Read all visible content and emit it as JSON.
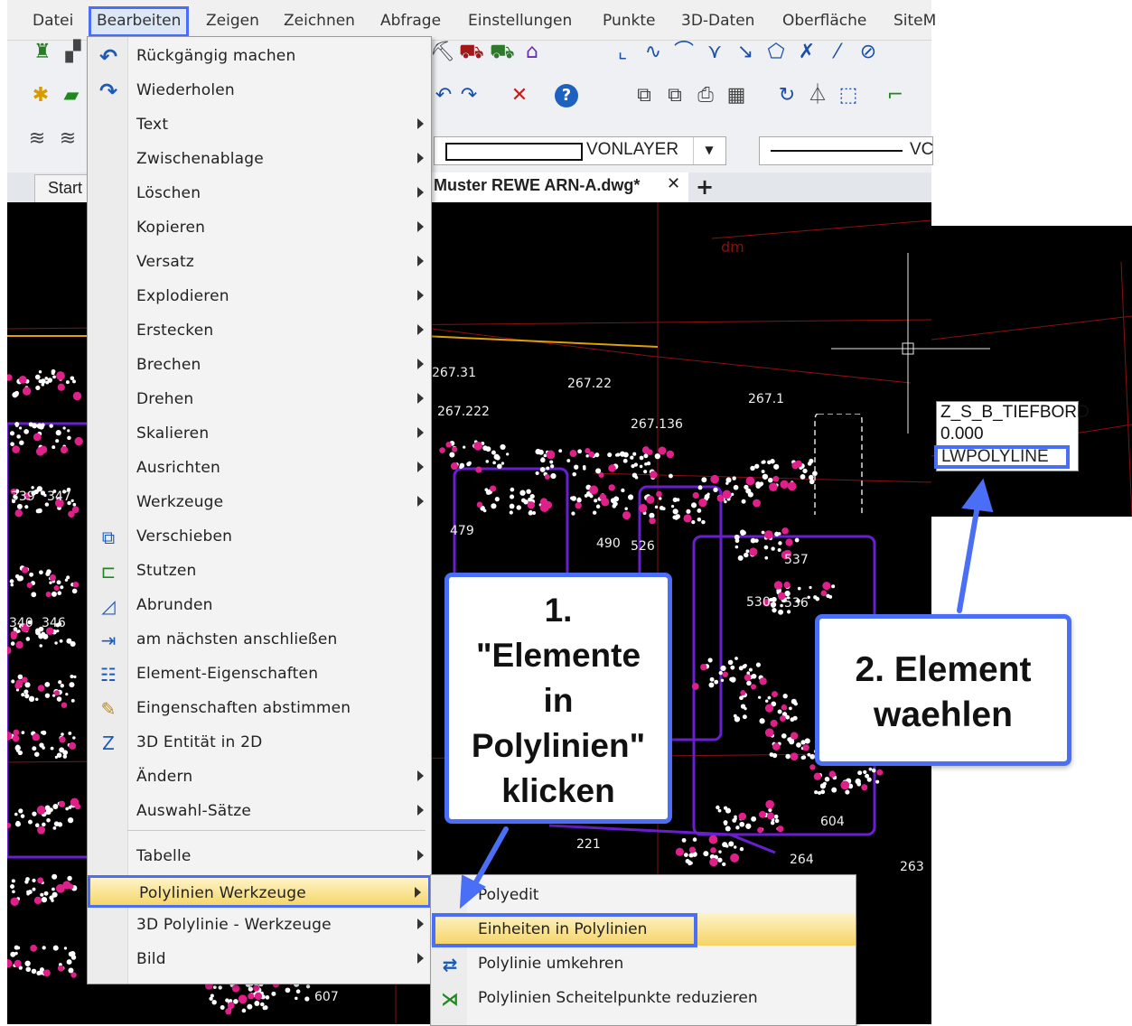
{
  "menubar": {
    "items": [
      "Datei",
      "Bearbeiten",
      "Zeigen",
      "Zeichnen",
      "Abfrage",
      "Einstellungen",
      "Punkte",
      "3D-Daten",
      "Oberfläche",
      "SiteM"
    ]
  },
  "toolbar": {
    "linetype_value": "VONLAYER",
    "linetype2_value": "VC"
  },
  "tabs": {
    "start": "Start",
    "document": "Muster REWE ARN-A.dwg*",
    "close": "✕",
    "add": "+"
  },
  "menu": {
    "items": [
      {
        "label": "Rückgängig machen",
        "icon": "undo-icon"
      },
      {
        "label": "Wiederholen",
        "icon": "redo-icon"
      },
      {
        "label": "Text",
        "submenu": true
      },
      {
        "label": "Zwischenablage",
        "submenu": true
      },
      {
        "label": "Löschen",
        "submenu": true
      },
      {
        "label": "Kopieren",
        "submenu": true
      },
      {
        "label": "Versatz",
        "submenu": true
      },
      {
        "label": "Explodieren",
        "submenu": true
      },
      {
        "label": "Erstecken",
        "submenu": true
      },
      {
        "label": "Brechen",
        "submenu": true
      },
      {
        "label": "Drehen",
        "submenu": true
      },
      {
        "label": "Skalieren",
        "submenu": true
      },
      {
        "label": "Ausrichten",
        "submenu": true
      },
      {
        "label": "Werkzeuge",
        "submenu": true
      },
      {
        "label": "Verschieben",
        "icon": "move-icon"
      },
      {
        "label": "Stutzen",
        "icon": "trim-icon"
      },
      {
        "label": "Abrunden",
        "icon": "fillet-icon"
      },
      {
        "label": "am nächsten anschließen",
        "icon": "join-icon"
      },
      {
        "label": "Element-Eigenschaften",
        "icon": "properties-icon"
      },
      {
        "label": "Eingenschaften abstimmen",
        "icon": "match-properties-icon"
      },
      {
        "label": "3D Entität in 2D",
        "icon": "flatten-icon"
      },
      {
        "label": "Ändern",
        "submenu": true
      },
      {
        "label": "Auswahl-Sätze",
        "submenu": true
      },
      {
        "label": "Tabelle",
        "submenu": true
      },
      {
        "label": "Polylinien Werkzeuge",
        "submenu": true
      },
      {
        "label": "3D Polylinie - Werkzeuge",
        "submenu": true
      },
      {
        "label": "Bild",
        "submenu": true
      }
    ]
  },
  "submenu": {
    "items": [
      {
        "label": "Polyedit"
      },
      {
        "label": "Einheiten in Polylinien"
      },
      {
        "label": "Polylinie umkehren"
      },
      {
        "label": "Polylinien Scheitelpunkte reduzieren"
      }
    ]
  },
  "callout1": {
    "lines": [
      "1.",
      "\"Elemente",
      "in",
      "Polylinien\"",
      "klicken"
    ]
  },
  "callout2": {
    "lines": [
      "2. Element",
      "waehlen"
    ]
  },
  "tooltip": {
    "layer": "Z_S_B_TIEFBORD",
    "value": "0.000",
    "type": "LWPOLYLINE"
  },
  "drawing": {
    "labels": [
      "267.22",
      "267.1",
      "267.31",
      "267.136",
      "267.222",
      "479",
      "490",
      "526",
      "536",
      "530",
      "537",
      "263",
      "264",
      "607",
      "346",
      "340",
      "347",
      "339",
      "604",
      "221",
      "dm"
    ]
  }
}
